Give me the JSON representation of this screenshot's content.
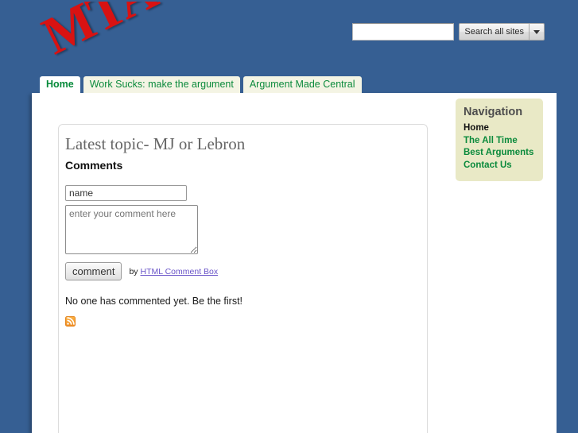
{
  "site": {
    "logo_text": "MTA",
    "background_color": "#365f93",
    "logo_color": "#d81212"
  },
  "search": {
    "value": "",
    "placeholder": "",
    "button_label": "Search all sites",
    "dropdown_icon": "chevron-down-icon"
  },
  "tabs": [
    {
      "label": "Home",
      "active": true
    },
    {
      "label": "Work Sucks: make the argument",
      "active": false
    },
    {
      "label": "Argument Made Central",
      "active": false
    }
  ],
  "main": {
    "topic_title": "Latest topic- MJ or Lebron",
    "comments_heading": "Comments",
    "name_input": {
      "value": "name",
      "placeholder": "name"
    },
    "comment_textarea": {
      "value": "enter your comment here",
      "placeholder": "enter your comment here"
    },
    "submit_button": "comment",
    "byline_prefix": "by",
    "byline_link": "HTML Comment Box",
    "empty_state": "No one has commented yet. Be the first!",
    "rss_icon": "rss-feed-icon",
    "link_color": "#6a55c8"
  },
  "navigation": {
    "title": "Navigation",
    "items": [
      {
        "label": "Home",
        "current": true
      },
      {
        "label": "The All Time Best Arguments",
        "current": false
      },
      {
        "label": "Contact Us",
        "current": false
      }
    ],
    "panel_color": "#e9e9c6",
    "link_color": "#0b8a3c"
  }
}
